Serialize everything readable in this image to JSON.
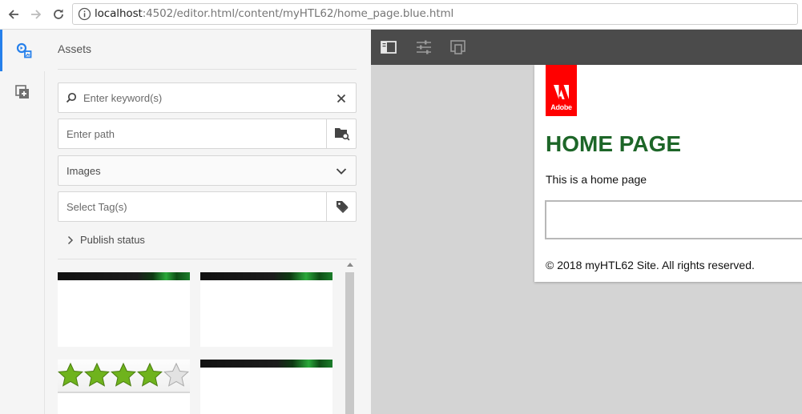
{
  "browser": {
    "url_host": "localhost",
    "url_rest": ":4502/editor.html/content/myHTL62/home_page.blue.html"
  },
  "rail": {
    "items": [
      {
        "icon": "asset-finder-icon",
        "active": true
      },
      {
        "icon": "components-icon",
        "active": false
      }
    ]
  },
  "assets_panel": {
    "title": "Assets",
    "search_placeholder": "Enter keyword(s)",
    "path_placeholder": "Enter path",
    "type_selected": "Images",
    "tags_placeholder": "Select Tag(s)",
    "publish_status_label": "Publish status"
  },
  "page": {
    "logo_text": "Adobe",
    "title": "HOME PAGE",
    "body_text": "This is a home page",
    "footer_text": "© 2018 myHTL62 Site. All rights reserved."
  },
  "colors": {
    "accent": "#2680eb",
    "toolbar": "#4b4b4b",
    "title_green": "#1d6628",
    "adobe_red": "#ff0000"
  }
}
